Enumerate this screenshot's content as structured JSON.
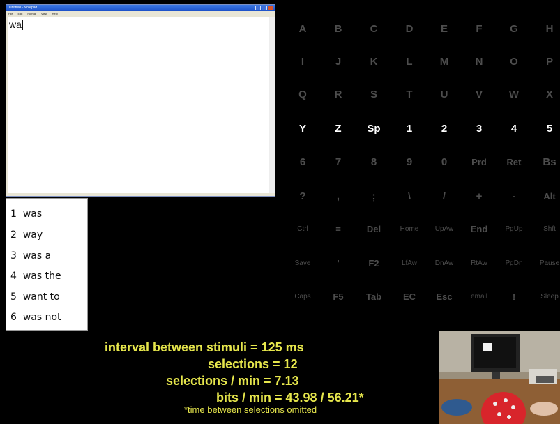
{
  "notepad": {
    "title": "Untitled - Notepad",
    "menu": [
      "File",
      "Edit",
      "Format",
      "View",
      "Help"
    ],
    "text": "wa"
  },
  "predictions": [
    {
      "num": "1",
      "word": "was"
    },
    {
      "num": "2",
      "word": "way"
    },
    {
      "num": "3",
      "word": "was a"
    },
    {
      "num": "4",
      "word": "was the"
    },
    {
      "num": "5",
      "word": "want to"
    },
    {
      "num": "6",
      "word": "was not"
    }
  ],
  "matrix": [
    [
      "A",
      "B",
      "C",
      "D",
      "E",
      "F",
      "G",
      "H"
    ],
    [
      "I",
      "J",
      "K",
      "L",
      "M",
      "N",
      "O",
      "P"
    ],
    [
      "Q",
      "R",
      "S",
      "T",
      "U",
      "V",
      "W",
      "X"
    ],
    [
      "Y",
      "Z",
      "Sp",
      "1",
      "2",
      "3",
      "4",
      "5"
    ],
    [
      "6",
      "7",
      "8",
      "9",
      "0",
      "Prd",
      "Ret",
      "Bs"
    ],
    [
      "?",
      ",",
      ";",
      "\\",
      "/",
      "+",
      "-",
      "Alt"
    ],
    [
      "Ctrl",
      "=",
      "Del",
      "Home",
      "UpAw",
      "End",
      "PgUp",
      "Shft"
    ],
    [
      "Save",
      "'",
      "F2",
      "LfAw",
      "DnAw",
      "RtAw",
      "PgDn",
      "Pause"
    ],
    [
      "Caps",
      "F5",
      "Tab",
      "EC",
      "Esc",
      "email",
      "!",
      "Sleep"
    ]
  ],
  "highlighted_row": 3,
  "stats": {
    "interval": "interval between stimuli = 125 ms",
    "selections": "selections = 12",
    "sel_per_min": "selections / min = 7.13",
    "bits_per_min": "bits / min = 43.98 / 56.21*",
    "footnote": "*time between selections omitted"
  },
  "colors": {
    "matrix_dim": "#4d4d4d",
    "matrix_highlight": "#ffffff",
    "stats_text": "#e6e64c"
  }
}
